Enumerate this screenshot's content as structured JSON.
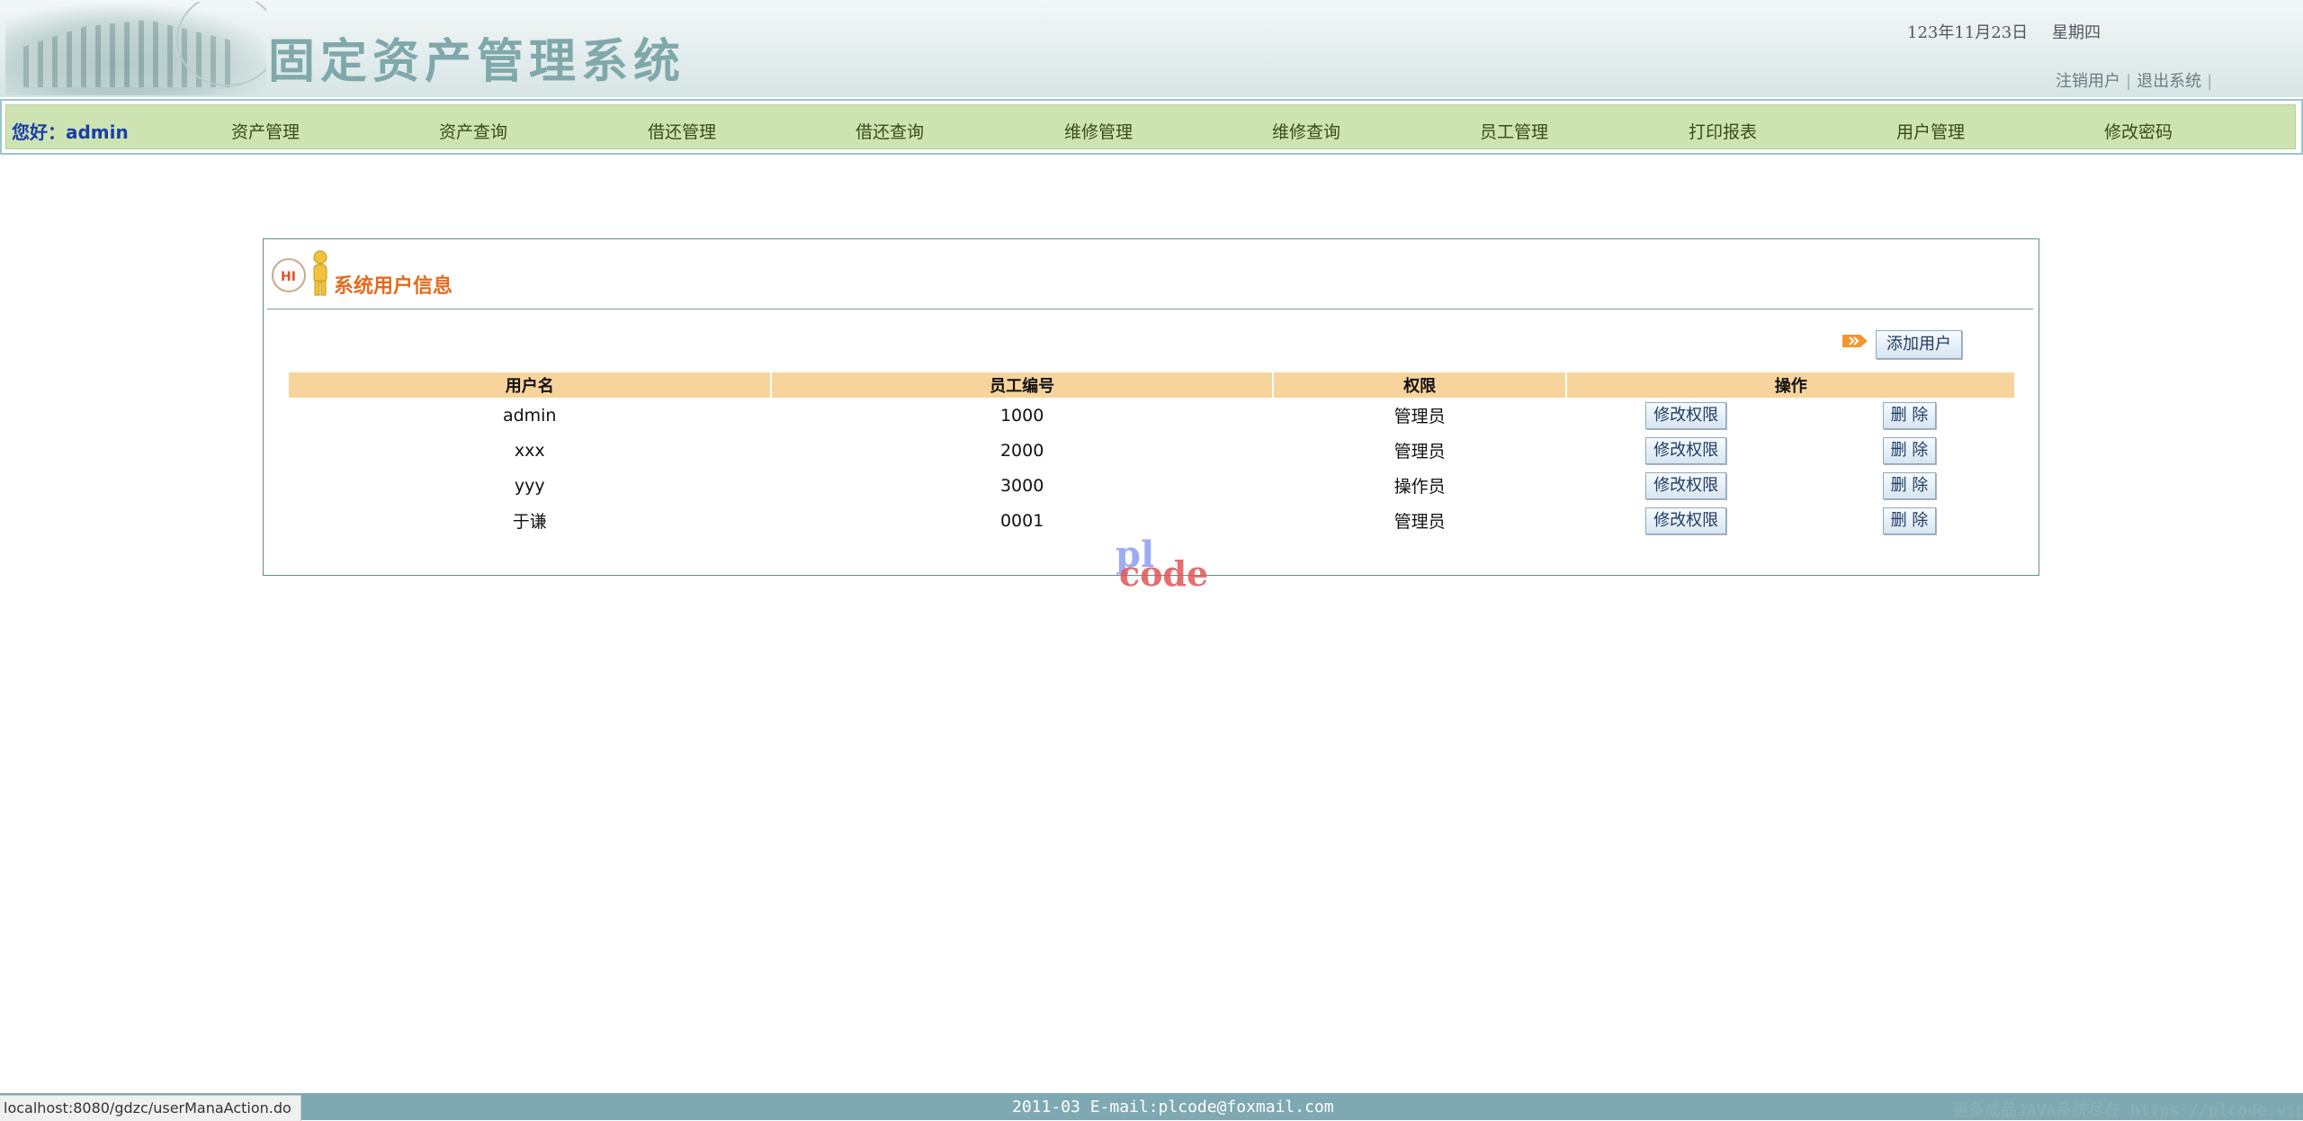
{
  "header": {
    "title": "固定资产管理系统",
    "date": "123年11月23日",
    "weekday": "星期四",
    "links": [
      "注销用户",
      "退出系统"
    ]
  },
  "nav": {
    "greeting": "您好：admin",
    "items": [
      "资产管理",
      "资产查询",
      "借还管理",
      "借还查询",
      "维修管理",
      "维修查询",
      "员工管理",
      "打印报表",
      "用户管理",
      "修改密码"
    ]
  },
  "panel": {
    "icon_text": "HI",
    "title": "系统用户信息",
    "add_button": "添加用户",
    "columns": [
      "用户名",
      "员工编号",
      "权限",
      "操作"
    ],
    "rows": [
      {
        "username": "admin",
        "emp_no": "1000",
        "role": "管理员"
      },
      {
        "username": "xxx",
        "emp_no": "2000",
        "role": "管理员"
      },
      {
        "username": "yyy",
        "emp_no": "3000",
        "role": "操作员"
      },
      {
        "username": "于谦",
        "emp_no": "0001",
        "role": "管理员"
      }
    ],
    "modify_label": "修改权限",
    "delete_label": "删 除"
  },
  "watermark": {
    "line1": "pl",
    "line2": "code"
  },
  "footer": {
    "text": "2011-03 E-mail:plcode@foxmail.com",
    "right_text": "更多成品JAVA系统尽在 https://plcode.vip"
  },
  "status_url": "localhost:8080/gdzc/userManaAction.do"
}
